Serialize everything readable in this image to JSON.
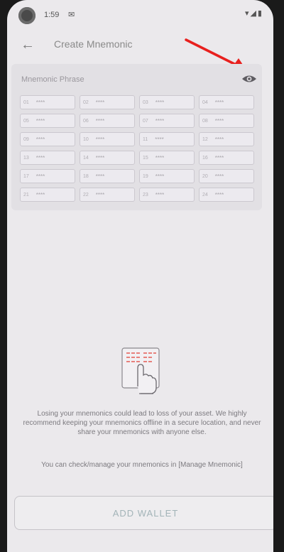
{
  "status": {
    "time": "1:59",
    "notification_icon": "message-icon",
    "right_icons": "▾◢▮"
  },
  "header": {
    "title": "Create Mnemonic",
    "back_icon": "back-arrow-icon"
  },
  "mnemonic": {
    "label": "Mnemonic Phrase",
    "visibility_icon": "eye-icon",
    "words": [
      {
        "num": "01",
        "mask": "****"
      },
      {
        "num": "02",
        "mask": "****"
      },
      {
        "num": "03",
        "mask": "****"
      },
      {
        "num": "04",
        "mask": "****"
      },
      {
        "num": "05",
        "mask": "****"
      },
      {
        "num": "06",
        "mask": "****"
      },
      {
        "num": "07",
        "mask": "****"
      },
      {
        "num": "08",
        "mask": "****"
      },
      {
        "num": "09",
        "mask": "****"
      },
      {
        "num": "10",
        "mask": "****"
      },
      {
        "num": "11",
        "mask": "****"
      },
      {
        "num": "12",
        "mask": "****"
      },
      {
        "num": "13",
        "mask": "****"
      },
      {
        "num": "14",
        "mask": "****"
      },
      {
        "num": "15",
        "mask": "****"
      },
      {
        "num": "16",
        "mask": "****"
      },
      {
        "num": "17",
        "mask": "****"
      },
      {
        "num": "18",
        "mask": "****"
      },
      {
        "num": "19",
        "mask": "****"
      },
      {
        "num": "20",
        "mask": "****"
      },
      {
        "num": "21",
        "mask": "****"
      },
      {
        "num": "22",
        "mask": "****"
      },
      {
        "num": "23",
        "mask": "****"
      },
      {
        "num": "24",
        "mask": "****"
      }
    ]
  },
  "info": {
    "warning": "Losing your mnemonics could lead to loss of your asset. We highly recommend keeping your mnemonics offline in a secure location, and never share your mnemonics with anyone else.",
    "manage_note": "You can check/manage your mnemonics in [Manage Mnemonic]"
  },
  "actions": {
    "add_wallet": "ADD WALLET"
  },
  "colors": {
    "background": "#ebe9ec",
    "annotation_arrow": "#e8201e",
    "button_text": "#a3b4b8"
  }
}
